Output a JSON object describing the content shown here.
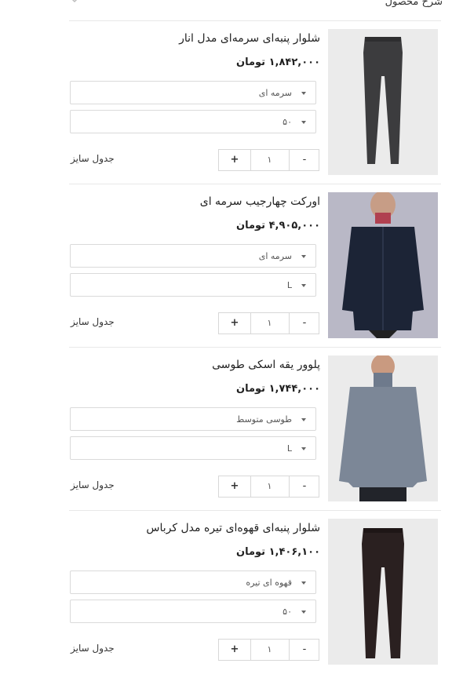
{
  "header": {
    "title": "شرح محصول"
  },
  "size_chart_label": "جدول سایز",
  "products": [
    {
      "name": "شلوار پنبه‌ای سرمه‌ای مدل انار",
      "price": "۱,۸۴۲,۰۰۰ تومان",
      "color": "سرمه ای",
      "size": "۵۰",
      "qty": "۱",
      "plus": "+",
      "minus": "-",
      "image": "pants-icon",
      "image_color": "#3c3c3e"
    },
    {
      "name": "اورکت چهارجیب سرمه ای",
      "price": "۴,۹۰۵,۰۰۰ تومان",
      "color": "سرمه ای",
      "size": "L",
      "qty": "۱",
      "plus": "+",
      "minus": "-",
      "image": "jacket-icon",
      "image_color": "#1c2436"
    },
    {
      "name": "پلوور یقه اسکی طوسی",
      "price": "۱,۷۴۴,۰۰۰ تومان",
      "color": "طوسی متوسط",
      "size": "L",
      "qty": "۱",
      "plus": "+",
      "minus": "-",
      "image": "sweater-icon",
      "image_color": "#7c8797"
    },
    {
      "name": "شلوار پنبه‌ای قهوه‌ای تیره مدل کرباس",
      "price": "۱,۴۰۶,۱۰۰ تومان",
      "color": "قهوه ای تیره",
      "size": "۵۰",
      "qty": "۱",
      "plus": "+",
      "minus": "-",
      "image": "pants-icon",
      "image_color": "#2a2020"
    }
  ]
}
